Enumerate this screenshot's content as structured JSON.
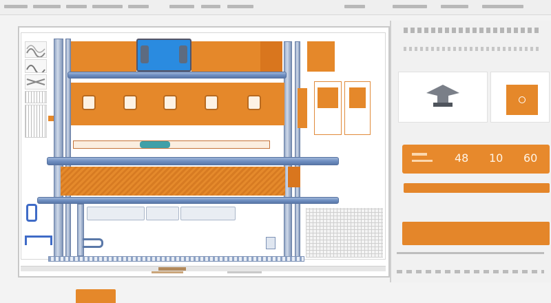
{
  "readout": {
    "value_a": "48",
    "value_b": "10",
    "value_c": "60"
  },
  "colors": {
    "accent": "#e5882a",
    "steel": "#6f8fc2",
    "panel": "#f1f1f1"
  },
  "icons": {
    "toolbar_tools": [
      "wave-tool-icon",
      "wave-tool-icon",
      "weave-tool-icon",
      "grid-tool-icon"
    ],
    "selected_part": "bracket-part-icon",
    "part_preview": "circular-port-icon"
  }
}
